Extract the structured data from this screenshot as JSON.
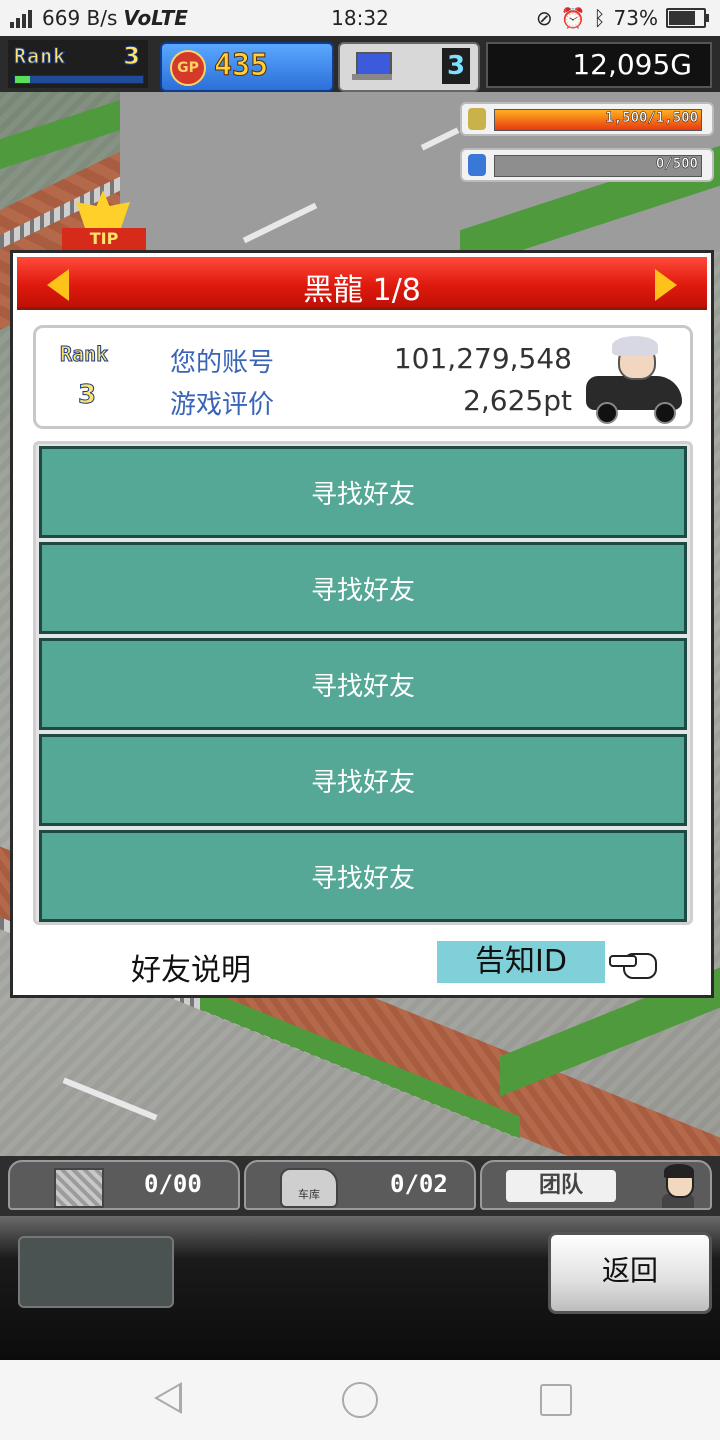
{
  "status_bar": {
    "network": "4G",
    "speed": "669 B/s",
    "volte": "VoLTE",
    "time": "18:32",
    "battery": "73%",
    "battery_level": 0.73
  },
  "top_bar": {
    "rank_label": "Rank",
    "rank_value": "3",
    "rank_progress": 0.12,
    "gp_icon_label": "GP",
    "gp_value": "435",
    "pc_value": "3",
    "money": "12,095G"
  },
  "resources": [
    {
      "name": "coins",
      "text": "1,500/1,500",
      "fill": 1.0,
      "icon_color": "#c9b24a"
    },
    {
      "name": "fuel",
      "text": "0/500",
      "fill": 0.0,
      "icon_color": "#3a78d8"
    }
  ],
  "tip_badge": "TIP",
  "dialog": {
    "title": "黑龍 1/8",
    "profile": {
      "rank_label": "Rank",
      "rank_value": "3",
      "account_label": "您的账号",
      "account_value": "101,279,548",
      "rating_label": "游戏评价",
      "rating_value": "2,625pt"
    },
    "slots": [
      "寻找好友",
      "寻找好友",
      "寻找好友",
      "寻找好友",
      "寻找好友"
    ],
    "explain_label": "好友说明",
    "notify_label": "告知ID"
  },
  "dock": {
    "crate_count": "0/00",
    "garage_label": "车库",
    "garage_count": "0/02",
    "team_label": "团队"
  },
  "panel": {
    "back_label": "返回"
  },
  "colors": {
    "slot_teal": "#55a896",
    "header_red": "#e01a0e",
    "label_blue": "#3a64b8"
  }
}
